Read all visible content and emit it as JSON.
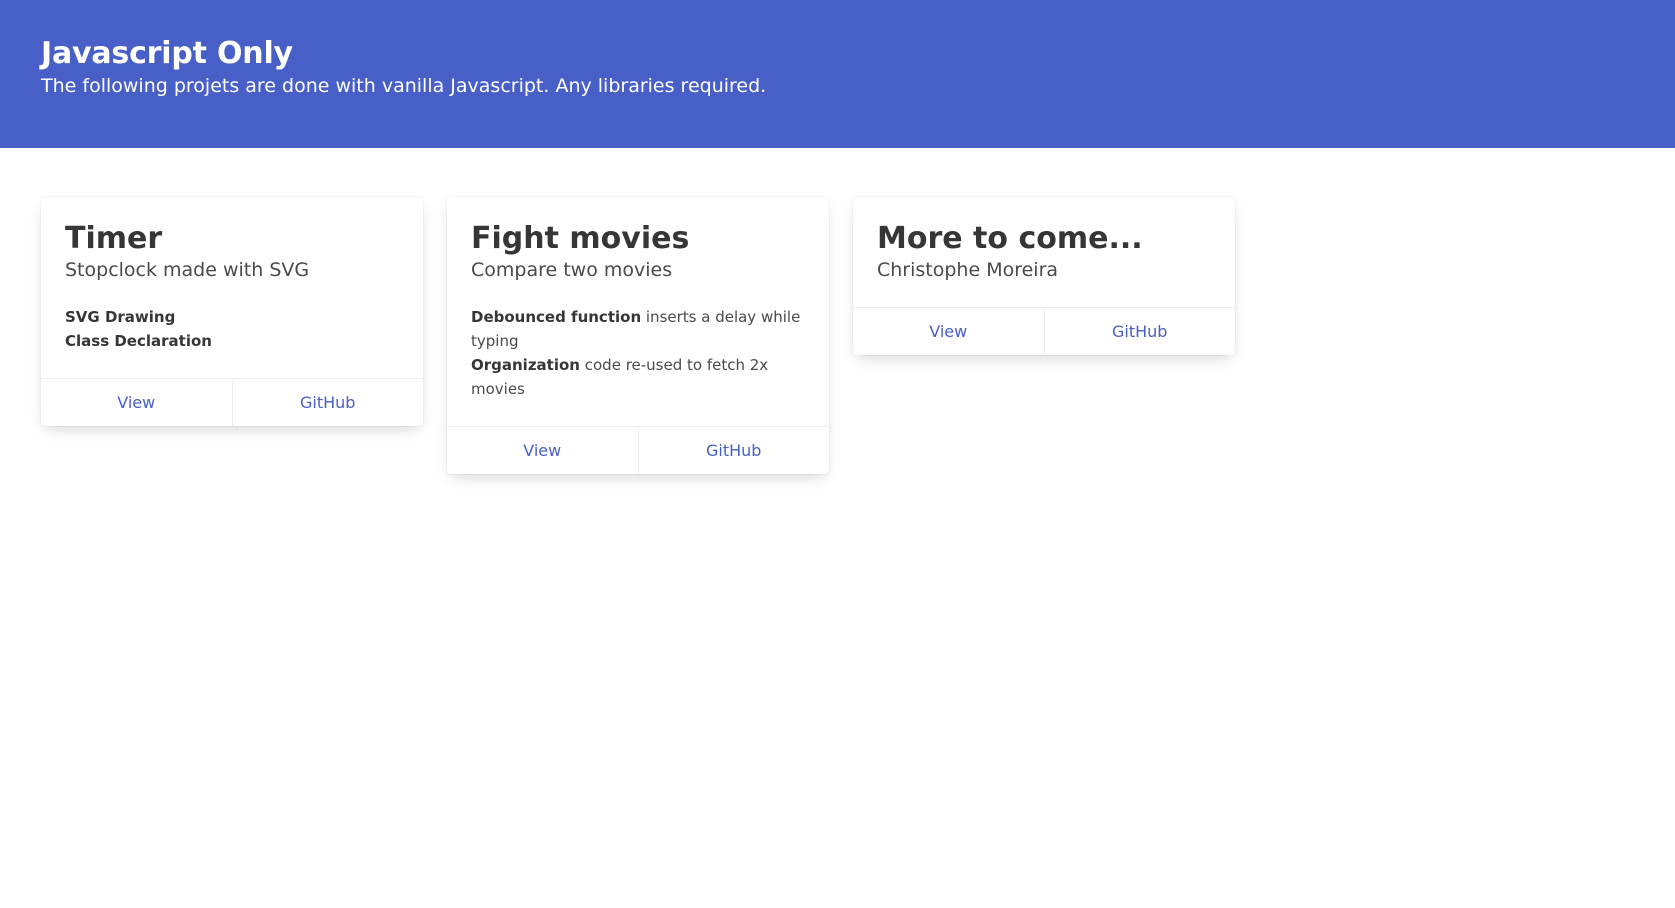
{
  "hero": {
    "title": "Javascript Only",
    "subtitle": "The following projets are done with vanilla Javascript. Any libraries required."
  },
  "cards": [
    {
      "title": "Timer",
      "subtitle": "Stopclock made with SVG",
      "lines": [
        {
          "bold": "SVG Drawing",
          "text": ""
        },
        {
          "bold": "Class Declaration",
          "text": ""
        }
      ],
      "view_label": "View",
      "github_label": "GitHub"
    },
    {
      "title": "Fight movies",
      "subtitle": "Compare two movies",
      "lines": [
        {
          "bold": "Debounced function",
          "text": " inserts a delay while typing"
        },
        {
          "bold": "Organization",
          "text": " code re-used to fetch 2x movies"
        }
      ],
      "view_label": "View",
      "github_label": "GitHub"
    },
    {
      "title": "More to come...",
      "subtitle": "Christophe Moreira",
      "view_label": "View",
      "github_label": "GitHub"
    }
  ],
  "colors": {
    "primary": "#485fc7",
    "text": "#363636"
  }
}
